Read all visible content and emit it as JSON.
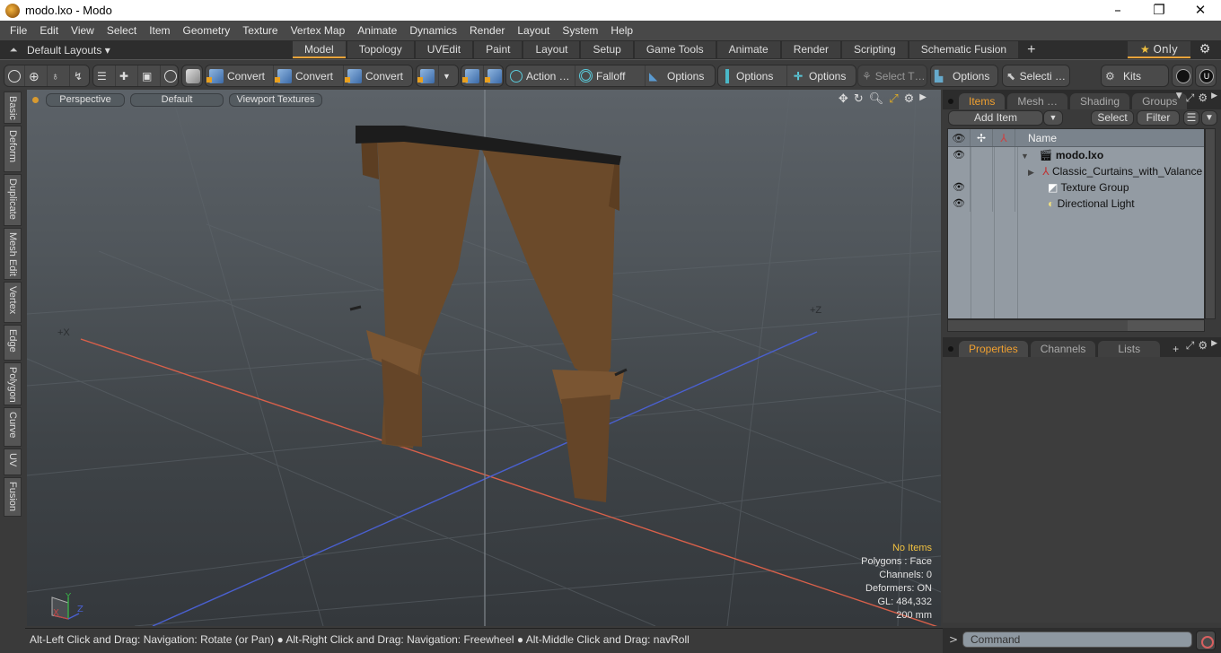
{
  "titlebar": {
    "title": "modo.lxo - Modo",
    "min": "–",
    "max": "❐",
    "close": "✕"
  },
  "menu": [
    "File",
    "Edit",
    "View",
    "Select",
    "Item",
    "Geometry",
    "Texture",
    "Vertex Map",
    "Animate",
    "Dynamics",
    "Render",
    "Layout",
    "System",
    "Help"
  ],
  "layouts": {
    "default_layouts": "Default Layouts ▾",
    "tabs": [
      "Model",
      "Topology",
      "UVEdit",
      "Paint",
      "Layout",
      "Setup",
      "Game Tools",
      "Animate",
      "Render",
      "Scripting",
      "Schematic Fusion"
    ],
    "active_tab": "Model",
    "add_tab": "+",
    "only_label": "Only",
    "star": "★"
  },
  "toolbar": {
    "convert1": "Convert",
    "convert2": "Convert",
    "convert3": "Convert",
    "action": "Action  …",
    "falloff": "Falloff",
    "options1": "Options",
    "options2": "Options",
    "options3": "Options",
    "select_t": "Select T…",
    "options4": "Options",
    "selecti": "Selecti …",
    "kits": "Kits"
  },
  "left_tabs": [
    "Basic",
    "Deform",
    "Duplicate",
    "Mesh Edit",
    "Vertex",
    "Edge",
    "Polygon",
    "Curve",
    "UV",
    "Fusion"
  ],
  "viewport": {
    "view_type": "Perspective",
    "shading": "Default",
    "textures": "Viewport Textures",
    "axis_x": "+X",
    "axis_z": "+Z",
    "gizmo": {
      "x": "X",
      "y": "Y",
      "z": "Z"
    },
    "hud": {
      "selection": "No Items",
      "polygons": "Polygons : Face",
      "channels": "Channels: 0",
      "deformers": "Deformers: ON",
      "gl": "GL: 484,332",
      "scale": "200 mm"
    },
    "colors": {
      "curtain": "#6b4a2a",
      "valance": "#1c1c1c",
      "x_axis": "#d8604a",
      "z_axis": "#4a60d0"
    }
  },
  "status": {
    "hint": "Alt-Left Click and Drag: Navigation: Rotate (or Pan) ● Alt-Right Click and Drag: Navigation: Freewheel ● Alt-Middle Click and Drag: navRoll"
  },
  "items_panel": {
    "tabs": [
      "Items",
      "Mesh …",
      "Shading",
      "Groups"
    ],
    "active_tab": "Items",
    "add_item": "Add Item",
    "select": "Select",
    "filter": "Filter",
    "column_name": "Name",
    "tree": [
      {
        "name": "modo.lxo",
        "visible": true,
        "expanded": true,
        "level": 0,
        "icon": "scene-icon"
      },
      {
        "name": "Classic_Curtains_with_Valance",
        "visible": false,
        "expanded": false,
        "level": 1,
        "icon": "mesh-locator-icon"
      },
      {
        "name": "Texture Group",
        "visible": true,
        "level": 1,
        "icon": "texture-group-icon"
      },
      {
        "name": "Directional Light",
        "visible": true,
        "level": 1,
        "icon": "light-icon"
      }
    ]
  },
  "properties_panel": {
    "tabs": [
      "Properties",
      "Channels",
      "Lists"
    ],
    "active_tab": "Properties",
    "add_tab": "+"
  },
  "command": {
    "prompt": ">",
    "placeholder": "Command"
  },
  "accent": "#e8a33a"
}
